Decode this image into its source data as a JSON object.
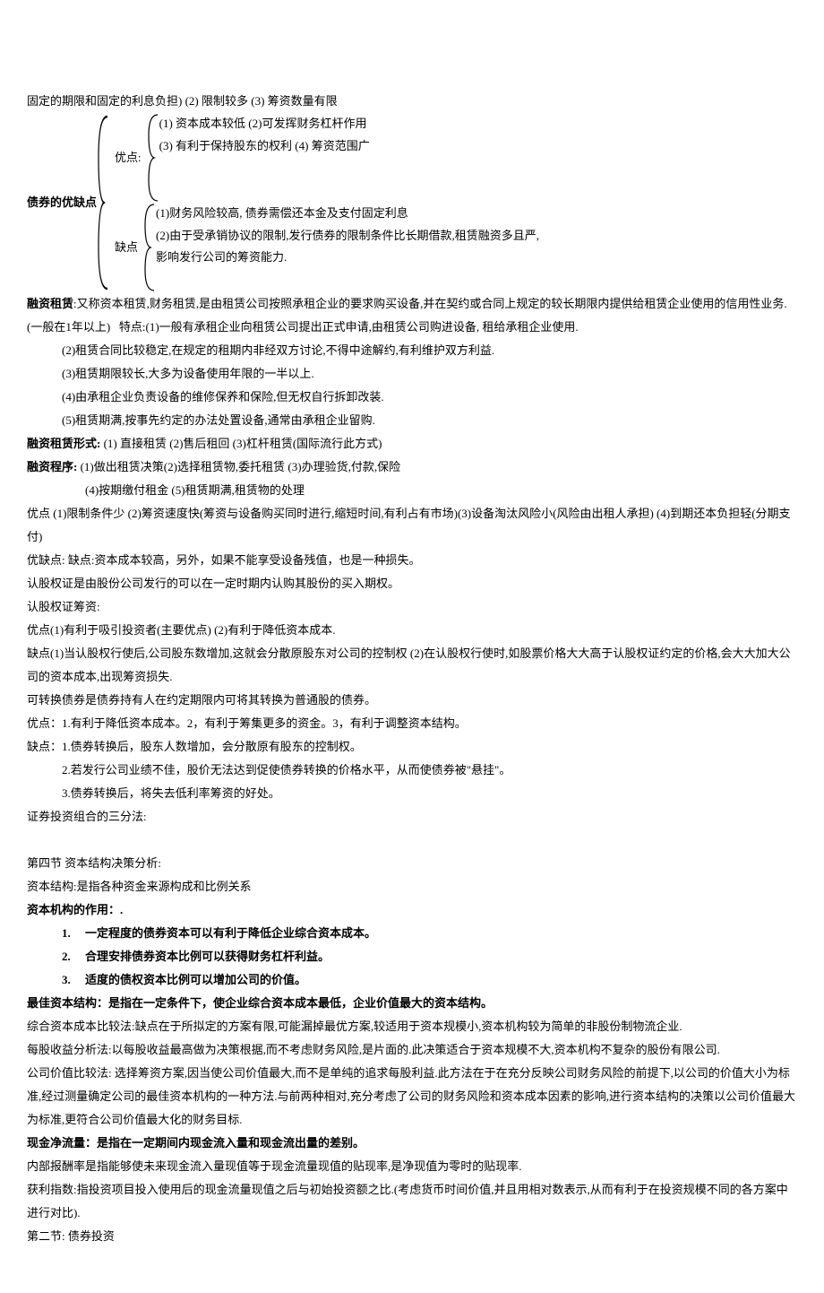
{
  "l1": "固定的期限和固定的利息负担)  (2) 限制较多 (3) 筹资数量有限",
  "bond": {
    "label": "债券的优缺点",
    "adv_label": "优点:",
    "dis_label": "缺点",
    "adv1": "(1) 资本成本较低  (2)可发挥财务杠杆作用",
    "adv2": "(3) 有利于保持股东的权利 (4) 筹资范围广",
    "dis1": "(1)财务风险较高, 债券需偿还本金及支付固定利息",
    "dis2": "(2)由于受承销协议的限制,发行债券的限制条件比长期借款,租赁融资多且严,",
    "dis3": "  影响发行公司的筹资能力."
  },
  "lease_def": "融资租赁:又称资本租赁,财务租赁,是由租赁公司按照承租企业的要求购买设备,并在契约或合同上规定的较长期限内提供给租赁企业使用的信用性业务.(一般在1年以上)   特点:(1)一般有承租企业向租赁公司提出正式申请,由租赁公司购进设备, 租给承租企业使用.",
  "lease2": "(2)租赁合同比较稳定,在规定的租期内非经双方讨论,不得中途解约,有利维护双方利益.",
  "lease3": "(3)租赁期限较长,大多为设备使用年限的一半以上.",
  "lease4": "(4)由承租企业负责设备的维修保养和保险,但无权自行拆卸改装.",
  "lease5": "(5)租赁期满,按事先约定的办法处置设备,通常由承租企业留购.",
  "lease_form_lbl": "融资租赁形式:",
  "lease_form": " (1) 直接租赁  (2)售后租回   (3)杠杆租赁(国际流行此方式)",
  "lease_proc_lbl": "融资程序:",
  "lease_proc1": " (1)做出租赁决策(2)选择租赁物,委托租赁 (3)办理验货,付款,保险",
  "lease_proc2": "(4)按期缴付租金 (5)租赁期满,租赁物的处理",
  "lease_adv": "    优点   (1)限制条件少  (2)筹资速度快(筹资与设备购买同时进行,缩短时间,有利占有市场)(3)设备淘汰风险小(风险由出租人承担)  (4)到期还本负担轻(分期支付)",
  "lease_dis": "优缺点:   缺点:资本成本较高，另外，如果不能享受设备残值，也是一种损失。",
  "warrant_def": "认股权证是由股份公司发行的可以在一定时期内认购其股份的买入期权。",
  "warrant_fin": "认股权证筹资:",
  "warrant_adv": "优点(1)有利于吸引投资者(主要优点)  (2)有利于降低资本成本.",
  "warrant_dis": "缺点(1)当认股权行使后,公司股东数增加,这就会分散原股东对公司的控制权 (2)在认股权行使时,如股票价格大大高于认股权证约定的价格,会大大加大公司的资本成本,出现筹资损失.",
  "conv_def": "可转换债券是债券持有人在约定期限内可将其转换为普通股的债券。",
  "conv_adv": "优点：1.有利于降低资本成本。2，有利于筹集更多的资金。3，有利于调整资本结构。",
  "conv_dis1": "缺点：1.债券转换后，股东人数增加，会分散原有股东的控制权。",
  "conv_dis2": "2.若发行公司业绩不佳，股价无法达到促使债券转换的价格水平，从而使债券被\"悬挂\"。",
  "conv_dis3": "3.债券转换后，将失去低利率筹资的好处。",
  "port": "证券投资组合的三分法:",
  "sec4": "第四节 资本结构决策分析:",
  "capstruct": "  资本结构:是指各种资金来源构成和比例关系",
  "caprole_lbl": "资本机构的作用：.",
  "caprole1": "一定程度的债券资本可以有利于降低企业综合资本成本。",
  "caprole2": "合理安排债券资本比例可以获得财务杠杆利益。",
  "caprole3": "适度的债权资本比例可以增加公司的价值。",
  "bestcap": "最佳资本结构：是指在一定条件下，使企业综合资本成本最低，企业价值最大的资本结构。",
  "m1": "  综合资本成本比较法:缺点在于所拟定的方案有限,可能漏掉最优方案,较适用于资本规模小,资本机构较为简单的非股份制物流企业.",
  "m2": "每股收益分析法:以每股收益最高做为决策根据,而不考虑财务风险,是片面的.此决策适合于资本规模不大,资本机构不复杂的股份有限公司.",
  "m3": "  公司价值比较法:  选择筹资方案,因当使公司价值最大,而不是单纯的追求每股利益.此方法在于在充分反映公司财务风险的前提下,以公司的价值大小为标准,经过测量确定公司的最佳资本机构的一种方法.与前两种相对,充分考虑了公司的财务风险和资本成本因素的影响,进行资本结构的决策以公司价值最大为标准,更符合公司价值最大化的财务目标.",
  "ncf": "现金净流量：是指在一定期间内现金流入量和现金流出量的差别。",
  "irr": "内部报酬率是指能够使未来现金流入量现值等于现金流量现值的贴现率,是净现值为零时的贴现率.",
  "pi": "获利指数:指投资项目投入使用后的现金流量现值之后与初始投资额之比.(考虑货币时间价值,并且用相对数表示,从而有利于在投资规模不同的各方案中进行对比).",
  "sec2": "第二节: 债券投资"
}
